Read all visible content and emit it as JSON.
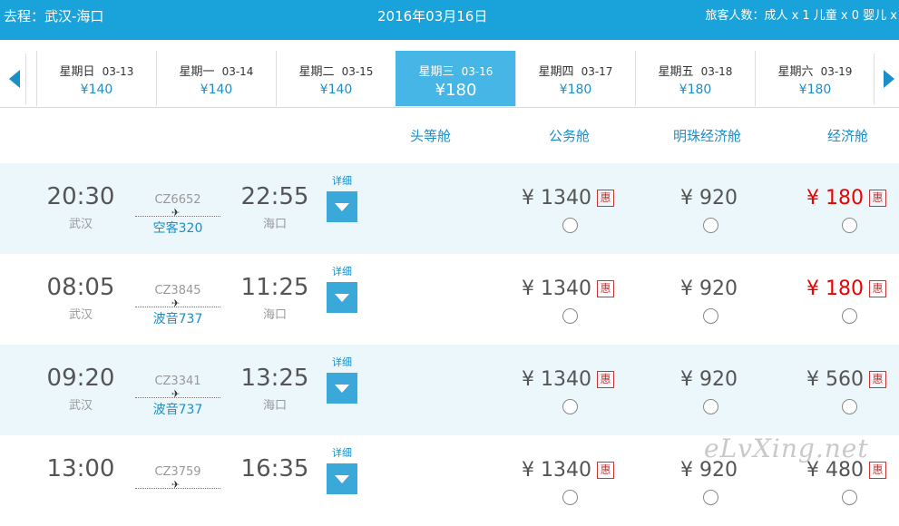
{
  "header": {
    "route": "去程：武汉-海口",
    "date": "2016年03月16日",
    "passengers": "旅客人数：成人 x 1   儿童 x 0   婴儿 x"
  },
  "dates": [
    {
      "weekday": "星期日",
      "date": "03-13",
      "price": "¥140"
    },
    {
      "weekday": "星期一",
      "date": "03-14",
      "price": "¥140"
    },
    {
      "weekday": "星期二",
      "date": "03-15",
      "price": "¥140"
    },
    {
      "weekday": "星期三",
      "date": "03-16",
      "price": "¥180"
    },
    {
      "weekday": "星期四",
      "date": "03-17",
      "price": "¥180"
    },
    {
      "weekday": "星期五",
      "date": "03-18",
      "price": "¥180"
    },
    {
      "weekday": "星期六",
      "date": "03-19",
      "price": "¥180"
    }
  ],
  "cabins": [
    "头等舱",
    "公务舱",
    "明珠经济舱",
    "经济舱"
  ],
  "flights": [
    {
      "dep_time": "20:30",
      "dep_city": "武汉",
      "flight_no": "CZ6652",
      "aircraft": "空客320",
      "arr_time": "22:55",
      "arr_city": "海口",
      "detail": "详细",
      "business": "¥ 1340",
      "pearl": "¥ 920",
      "economy": "¥ 180",
      "economy_red": true
    },
    {
      "dep_time": "08:05",
      "dep_city": "武汉",
      "flight_no": "CZ3845",
      "aircraft": "波音737",
      "arr_time": "11:25",
      "arr_city": "海口",
      "detail": "详细",
      "business": "¥ 1340",
      "pearl": "¥ 920",
      "economy": "¥ 180",
      "economy_red": true
    },
    {
      "dep_time": "09:20",
      "dep_city": "武汉",
      "flight_no": "CZ3341",
      "aircraft": "波音737",
      "arr_time": "13:25",
      "arr_city": "海口",
      "detail": "详细",
      "business": "¥ 1340",
      "pearl": "¥ 920",
      "economy": "¥ 560",
      "economy_red": false
    },
    {
      "dep_time": "13:00",
      "dep_city": "",
      "flight_no": "CZ3759",
      "aircraft": "",
      "arr_time": "16:35",
      "arr_city": "",
      "detail": "详细",
      "business": "¥ 1340",
      "pearl": "¥ 920",
      "economy": "¥ 480",
      "economy_red": false
    }
  ],
  "promo_tag": "惠",
  "watermark": "eLvXing.net",
  "colors": {
    "topbar": "#1aa3da",
    "accent": "#1a8fc9",
    "active_day": "#45b6e5",
    "row_shade": "#ecf7fb",
    "sale_price": "#e00000"
  }
}
